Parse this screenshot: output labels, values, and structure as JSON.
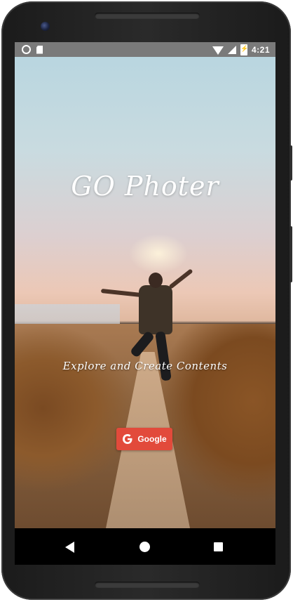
{
  "status_bar": {
    "time": "4:21",
    "icons": [
      "notification-ring-icon",
      "sd-card-icon",
      "wifi-icon",
      "signal-icon",
      "battery-charging-icon"
    ]
  },
  "splash": {
    "title": "GO Photer",
    "tagline": "Explore and Create Contents"
  },
  "google_button": {
    "label": "Google",
    "color": "#e24a3b",
    "icon": "google-g-icon"
  },
  "nav_bar": {
    "icons": [
      "back-icon",
      "home-icon",
      "recents-icon"
    ]
  }
}
